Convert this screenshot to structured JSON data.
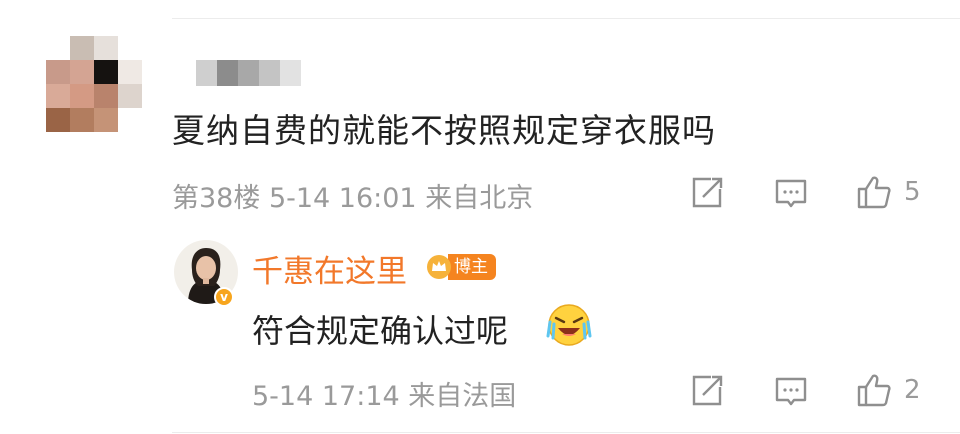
{
  "comment": {
    "text": "夏纳自费的就能不按照规定穿衣服吗",
    "meta": "第38楼 5-14 16:01 来自北京",
    "like_count": "5"
  },
  "reply": {
    "author": "千惠在这里",
    "author_badge": "博主",
    "text": "符合规定确认过呢",
    "meta": "5-14 17:14 来自法国",
    "like_count": "2"
  },
  "colors": {
    "author_name": "#f2782a",
    "badge_bg": "#f5841f",
    "meta_text": "#9a9a9a",
    "body_text": "#222222"
  },
  "icons": [
    "share-icon",
    "comment-icon",
    "like-icon",
    "verified-icon",
    "crown-icon",
    "laughing-emoji-icon"
  ]
}
